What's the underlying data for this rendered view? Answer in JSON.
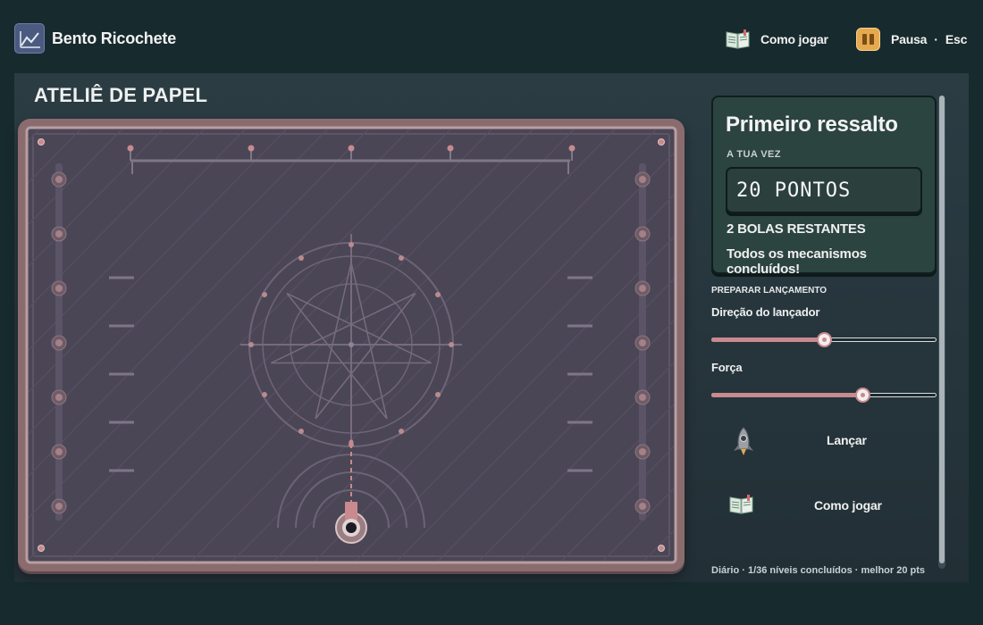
{
  "app": {
    "title": "Bento Ricochete",
    "icon": "chart-line-icon"
  },
  "topbar": {
    "howto_label": "Como jogar",
    "howto_icon": "book-icon",
    "pause_label": "Pausa",
    "pause_key": "Esc",
    "pause_icon": "pause-icon"
  },
  "level": {
    "name": "ATELIÊ DE PAPEL"
  },
  "status": {
    "title": "Primeiro ressalto",
    "turn_label": "A TUA VEZ",
    "score": "20 PONTOS",
    "balls_left": "2 BOLAS RESTANTES",
    "message": "Todos os mecanismos concluídos!"
  },
  "controls": {
    "section_label": "PREPARAR LANÇAMENTO",
    "direction_label": "Direção do lançador",
    "direction_value": 0.5,
    "force_label": "Força",
    "force_value": 0.67
  },
  "actions": {
    "launch_label": "Lançar",
    "launch_icon": "rocket-icon",
    "howto_label": "Como jogar",
    "howto_icon": "book-icon"
  },
  "footer": {
    "stats": "Diário · 1/36 níveis concluídos · melhor 20 pts"
  },
  "colors": {
    "background": "#172a2e",
    "board": "#4b4656",
    "board_frame": "#8a6c6f",
    "accent_pink": "#c88a8e",
    "card": "#2c4440",
    "pause_button": "#e5aa4f"
  }
}
